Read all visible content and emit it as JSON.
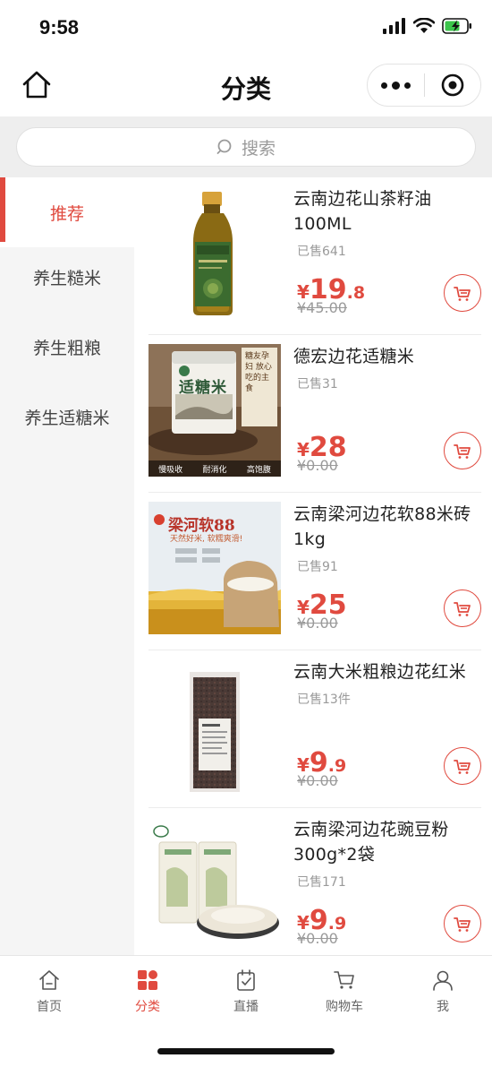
{
  "status_bar": {
    "time": "9:58"
  },
  "nav": {
    "title": "分类"
  },
  "search": {
    "placeholder": "搜索"
  },
  "sidebar": {
    "items": [
      {
        "label": "推荐",
        "active": true
      },
      {
        "label": "养生糙米",
        "active": false
      },
      {
        "label": "养生粗粮",
        "active": false
      },
      {
        "label": "养生适糖米",
        "active": false
      }
    ]
  },
  "products": [
    {
      "name": "云南边花山茶籽油100ML",
      "sold": "已售641",
      "currency": "¥",
      "price_int": "19",
      "price_dec": ".8",
      "original_price": "¥45.00"
    },
    {
      "name": "德宏边花适糖米",
      "sold": "已售31",
      "currency": "¥",
      "price_int": "28",
      "price_dec": "",
      "original_price": "¥0.00",
      "image_text": {
        "title": "适糖米",
        "side": "糖友孕妇 放心吃的主食",
        "bottom": [
          "慢吸收",
          "耐消化",
          "高饱腹"
        ]
      }
    },
    {
      "name": "云南梁河边花软88米砖1kg",
      "sold": "已售91",
      "currency": "¥",
      "price_int": "25",
      "price_dec": "",
      "original_price": "¥0.00",
      "image_text": {
        "title": "梁河软88",
        "sub": "天然好米, 软糯爽滑!"
      }
    },
    {
      "name": "云南大米粗粮边花红米",
      "sold": "已售13件",
      "currency": "¥",
      "price_int": "9",
      "price_dec": ".9",
      "original_price": "¥0.00"
    },
    {
      "name": "云南梁河边花豌豆粉300g*2袋",
      "sold": "已售171",
      "currency": "¥",
      "price_int": "9",
      "price_dec": ".9",
      "original_price": "¥0.00"
    }
  ],
  "tabbar": {
    "items": [
      {
        "label": "首页",
        "icon": "home-icon",
        "active": false
      },
      {
        "label": "分类",
        "icon": "category-icon",
        "active": true
      },
      {
        "label": "直播",
        "icon": "live-icon",
        "active": false
      },
      {
        "label": "购物车",
        "icon": "cart-icon",
        "active": false
      },
      {
        "label": "我",
        "icon": "user-icon",
        "active": false
      }
    ]
  },
  "colors": {
    "accent": "#e04a3f",
    "sidebar_bg": "#f5f5f5",
    "search_bg": "#eeeeee"
  }
}
